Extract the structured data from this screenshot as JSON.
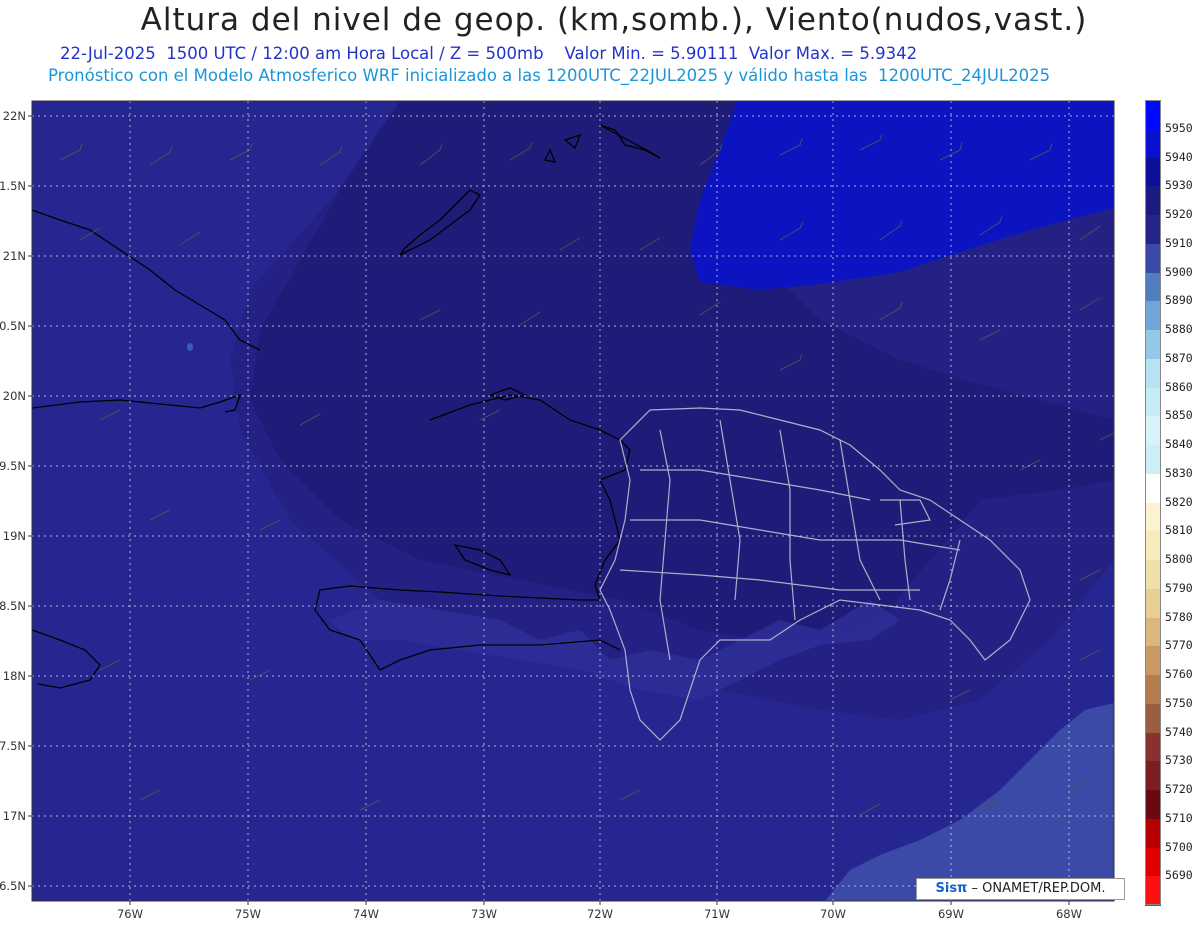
{
  "header": {
    "title": "Altura del nivel de geop. (km,somb.), Viento(nudos,vast.)",
    "line1": "22-Jul-2025  1500 UTC / 12:00 am Hora Local / Z = 500mb    Valor Min. = 5.90111  Valor Max. = 5.9342",
    "line2": "Pronóstico con el Modelo Atmosferico WRF inicializado a las 1200UTC_22JUL2025 y válido hasta las  1200UTC_24JUL2025"
  },
  "axes": {
    "lat_labels": [
      "22N",
      "1.5N",
      "21N",
      "0.5N",
      "20N",
      "9.5N",
      "19N",
      "8.5N",
      "18N",
      "7.5N",
      "17N",
      "6.5N"
    ],
    "lon_labels": [
      "76W",
      "75W",
      "74W",
      "73W",
      "72W",
      "71W",
      "70W",
      "69W",
      "68W"
    ]
  },
  "legend": {
    "labels": [
      "5950",
      "5940",
      "5930",
      "5920",
      "5910",
      "5900",
      "5890",
      "5880",
      "5870",
      "5860",
      "5850",
      "5840",
      "5830",
      "5820",
      "5810",
      "5800",
      "5790",
      "5780",
      "5770",
      "5760",
      "5750",
      "5740",
      "5730",
      "5720",
      "5710",
      "5700",
      "5690"
    ],
    "colors": [
      "#0008ff",
      "#0a10d0",
      "#0c0f9a",
      "#1a1a80",
      "#252588",
      "#3b4aa8",
      "#4f7fc0",
      "#6fa6d6",
      "#93c8e6",
      "#b6e2f2",
      "#c8ecf6",
      "#d8f2fa",
      "#cceff7",
      "#ffffff",
      "#fbf3cf",
      "#f6ebbb",
      "#efdfa8",
      "#e7cf94",
      "#dcb77b",
      "#c99863",
      "#b47c4f",
      "#9a5e40",
      "#8a3030",
      "#7a1e22",
      "#6a0a10",
      "#b80000",
      "#e00000",
      "#ff1010"
    ]
  },
  "credit": {
    "sis": "Sisπ",
    "text": " – ONAMET/REP.DOM."
  }
}
